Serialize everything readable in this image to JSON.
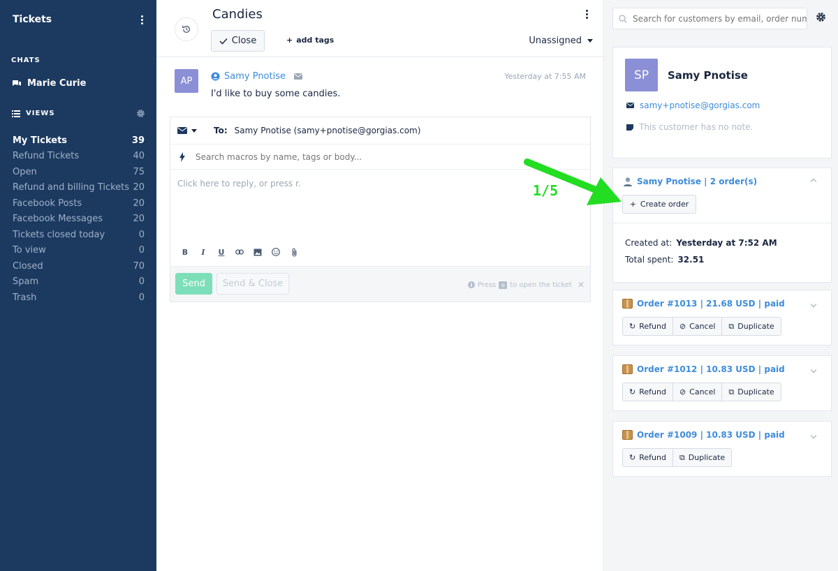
{
  "sidebar": {
    "title": "Tickets",
    "chats_label": "CHATS",
    "chat_item": "Marie Curie",
    "views_label": "VIEWS",
    "views": [
      {
        "label": "My Tickets",
        "count": "39",
        "active": true
      },
      {
        "label": "Refund Tickets",
        "count": "40"
      },
      {
        "label": "Open",
        "count": "75"
      },
      {
        "label": "Refund and billing Tickets",
        "count": "20"
      },
      {
        "label": "Facebook Posts",
        "count": "20"
      },
      {
        "label": "Facebook Messages",
        "count": "20"
      },
      {
        "label": "Tickets closed today",
        "count": "0"
      },
      {
        "label": "To view",
        "count": "0"
      },
      {
        "label": "Closed",
        "count": "70"
      },
      {
        "label": "Spam",
        "count": "0"
      },
      {
        "label": "Trash",
        "count": "0"
      }
    ]
  },
  "ticket": {
    "title": "Candies",
    "close_label": "Close",
    "add_tags_label": "add tags",
    "assignee": "Unassigned"
  },
  "message": {
    "avatar_initials": "AP",
    "author": "Samy Pnotise",
    "time": "Yesterday at 7:55 AM",
    "body": "I'd like to buy some candies."
  },
  "composer": {
    "to_label": "To:",
    "to_value": "Samy Pnotise (samy+pnotise@gorgias.com)",
    "macro_placeholder": "Search macros by name, tags or body...",
    "reply_placeholder": "Click here to reply, or press r.",
    "send_label": "Send",
    "send_close_label": "Send & Close",
    "hint_press": "Press",
    "hint_key": "o",
    "hint_rest": "to open the ticket"
  },
  "customer_panel": {
    "search_placeholder": "Search for customers by email, order number",
    "avatar_initials": "SP",
    "name": "Samy Pnotise",
    "email": "samy+pnotise@gorgias.com",
    "note": "This customer has no note.",
    "orders_header": "Samy Pnotise | 2 order(s)",
    "create_order_label": "Create order",
    "created_at_label": "Created at:",
    "created_at_value": "Yesterday at 7:52 AM",
    "total_spent_label": "Total spent:",
    "total_spent_value": "32.51",
    "orders": [
      {
        "title": "Order #1013 | 21.68 USD | paid",
        "actions": [
          "Refund",
          "Cancel",
          "Duplicate"
        ]
      },
      {
        "title": "Order #1012 | 10.83 USD | paid",
        "actions": [
          "Refund",
          "Cancel",
          "Duplicate"
        ]
      },
      {
        "title": "Order #1009 | 10.83 USD | paid",
        "actions": [
          "Refund",
          "Duplicate"
        ]
      }
    ]
  },
  "annotation": {
    "step_label": "1/5",
    "color": "#22dd22"
  },
  "colors": {
    "sidebar_bg": "#1c3a60",
    "link": "#3e8cda",
    "avatar": "#8a8fd6",
    "send": "#7ddfb9"
  }
}
